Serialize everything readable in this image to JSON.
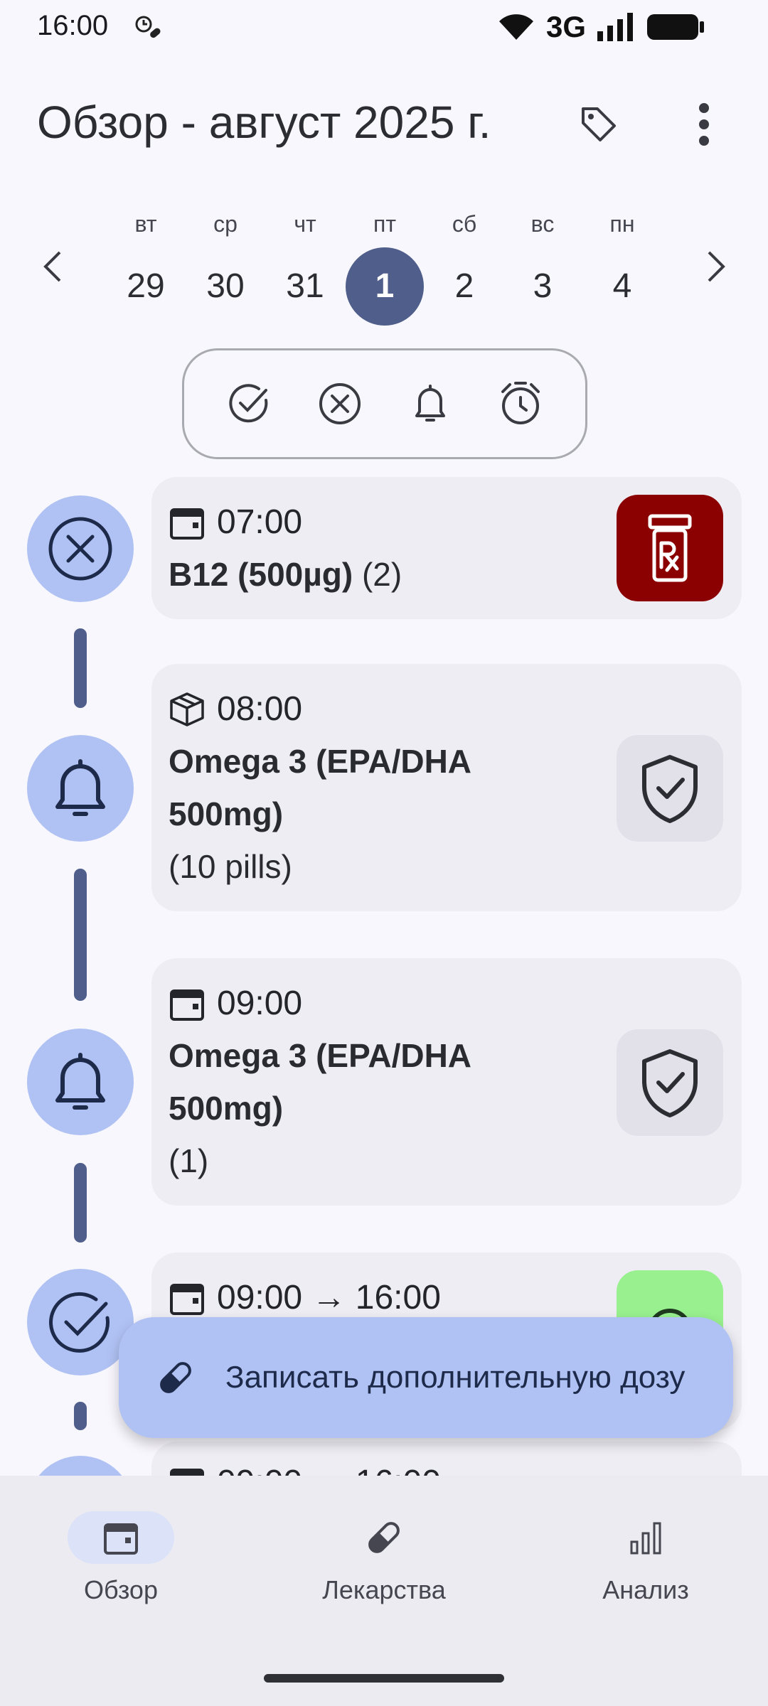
{
  "status": {
    "time": "16:00",
    "network": "3G"
  },
  "header": {
    "title": "Обзор - август 2025 г."
  },
  "week": {
    "days": [
      {
        "dow": "вт",
        "num": "29"
      },
      {
        "dow": "ср",
        "num": "30"
      },
      {
        "dow": "чт",
        "num": "31"
      },
      {
        "dow": "пт",
        "num": "1"
      },
      {
        "dow": "сб",
        "num": "2"
      },
      {
        "dow": "вс",
        "num": "3"
      },
      {
        "dow": "пн",
        "num": "4"
      }
    ],
    "selected": "1"
  },
  "filters": [
    "check-circle-icon",
    "x-circle-icon",
    "bell-icon",
    "alarm-clock-icon"
  ],
  "entries": [
    {
      "status_icon": "x-circle-icon",
      "time_icon": "calendar-icon",
      "time": "07:00",
      "name": "B12 (500µg)",
      "qty": "(2)",
      "action_icon": "rx-bottle-icon",
      "action_color": "#8B0000"
    },
    {
      "status_icon": "bell-icon",
      "time_icon": "box-icon",
      "time": "08:00",
      "name_line1": "Omega 3 (EPA/DHA",
      "name_line2": "500mg)",
      "qty": " (10 pills)",
      "action_icon": "shield-check-icon",
      "action_color": "#E2E1EA"
    },
    {
      "status_icon": "bell-icon",
      "time_icon": "calendar-icon",
      "time": "09:00",
      "name_line1": "Omega 3 (EPA/DHA",
      "name_line2": "500mg)",
      "qty": " (1)",
      "action_icon": "shield-check-icon",
      "action_color": "#E2E1EA"
    },
    {
      "status_icon": "check-circle-icon",
      "time_icon": "calendar-icon",
      "time": "09:00 → 16:00",
      "action_color": "#98F08E"
    },
    {
      "status_icon": "circle-icon",
      "time_icon": "calendar-icon",
      "time": "09:00 → 16:00"
    }
  ],
  "fab": {
    "label": "Записать дополнительную дозу"
  },
  "bottom_nav": [
    {
      "label": "Обзор",
      "icon": "calendar-icon",
      "active": true
    },
    {
      "label": "Лекарства",
      "icon": "pill-icon",
      "active": false
    },
    {
      "label": "Анализ",
      "icon": "bar-chart-icon",
      "active": false
    }
  ]
}
